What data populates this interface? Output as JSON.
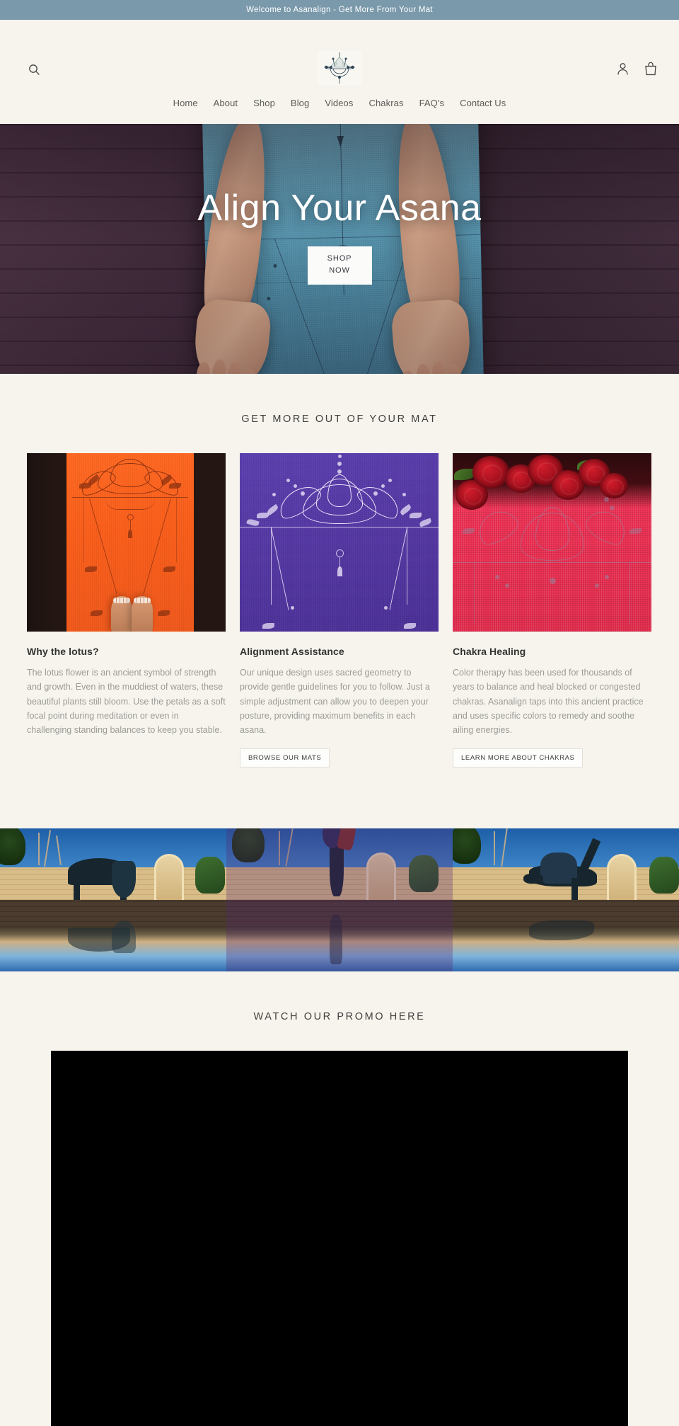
{
  "announcement": {
    "text": "Welcome to Asanalign - Get More From Your Mat"
  },
  "header": {
    "search_icon": "search-icon",
    "logo_alt": "Asanalign lotus logo",
    "account_icon": "account-icon",
    "cart_icon": "shopping-bag-icon"
  },
  "nav": {
    "items": [
      {
        "label": "Home"
      },
      {
        "label": "About"
      },
      {
        "label": "Shop"
      },
      {
        "label": "Blog"
      },
      {
        "label": "Videos"
      },
      {
        "label": "Chakras"
      },
      {
        "label": "FAQ's"
      },
      {
        "label": "Contact Us"
      }
    ]
  },
  "hero": {
    "title": "Align Your Asana",
    "button_line1": "SHOP",
    "button_line2": "NOW"
  },
  "features": {
    "title": "GET MORE OUT OF YOUR MAT",
    "columns": [
      {
        "image_alt": "Orange yoga mat with lotus sacred geometry and bare feet",
        "heading": "Why the lotus?",
        "body": "The lotus flower is an ancient symbol of strength and growth. Even in the muddiest of waters, these beautiful plants still bloom. Use the petals as a soft focal point during meditation or even in challenging standing balances to keep you stable.",
        "button": null
      },
      {
        "image_alt": "Purple yoga mat with white lotus alignment design",
        "heading": "Alignment Assistance",
        "body": "Our unique design uses sacred geometry to provide gentle guidelines for you to follow. Just a simple adjustment can allow you to deepen your posture, providing maximum benefits in each asana.",
        "button": "BROWSE OUR MATS"
      },
      {
        "image_alt": "Red yoga mat with red roses resting on it",
        "heading": "Chakra Healing",
        "body": "Color therapy has been used for thousands of years to balance and heal blocked or congested chakras. Asanalign taps into this ancient practice and uses specific colors to remedy and soothe ailing energies.",
        "button": "LEARN MORE ABOUT CHAKRAS"
      }
    ]
  },
  "gallery": {
    "images": [
      {
        "alt": "Yogi in forward fold by reflecting pool"
      },
      {
        "alt": "Yogi in handstand by reflecting pool"
      },
      {
        "alt": "Yogi in wild thing pose by reflecting pool"
      }
    ]
  },
  "video_section": {
    "title": "WATCH OUR PROMO HERE",
    "player_state": "video-player"
  },
  "colors": {
    "announcement_bg": "#7a99ab",
    "page_bg": "#f7f4ee",
    "text_dark": "#33332f",
    "text_muted": "#9b9b95",
    "mat_orange": "#fa5f1c",
    "mat_purple": "#5437a2",
    "mat_red": "#ec2f52"
  }
}
